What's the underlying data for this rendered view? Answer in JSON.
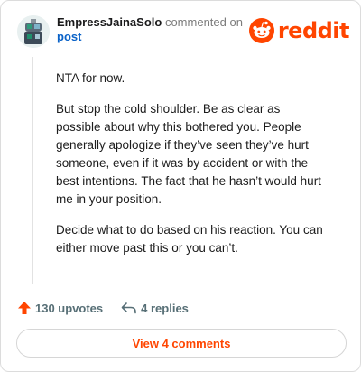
{
  "header": {
    "username": "EmpressJainaSolo",
    "action_text": "commented on",
    "post_link": "post",
    "brand": "reddit"
  },
  "comment": {
    "paragraphs": [
      "NTA for now.",
      "But stop the cold shoulder. Be as clear as possible about why this bothered you. People generally apologize if they’ve seen they’ve hurt someone, even if it was by accident or with the best intentions. The fact that he hasn’t would hurt me in your position.",
      "Decide what to do based on his reaction. You can either move past this or you can’t."
    ]
  },
  "actions": {
    "upvotes": "130 upvotes",
    "replies": "4 replies"
  },
  "footer": {
    "view_comments": "View 4 comments"
  },
  "colors": {
    "brand_orange": "#ff4500",
    "link_blue": "#0b63c8",
    "muted": "#576f76"
  },
  "icons": {
    "upvote": "upvote-arrow-icon",
    "reply": "reply-arrow-icon",
    "logo": "reddit-snoo-icon"
  }
}
